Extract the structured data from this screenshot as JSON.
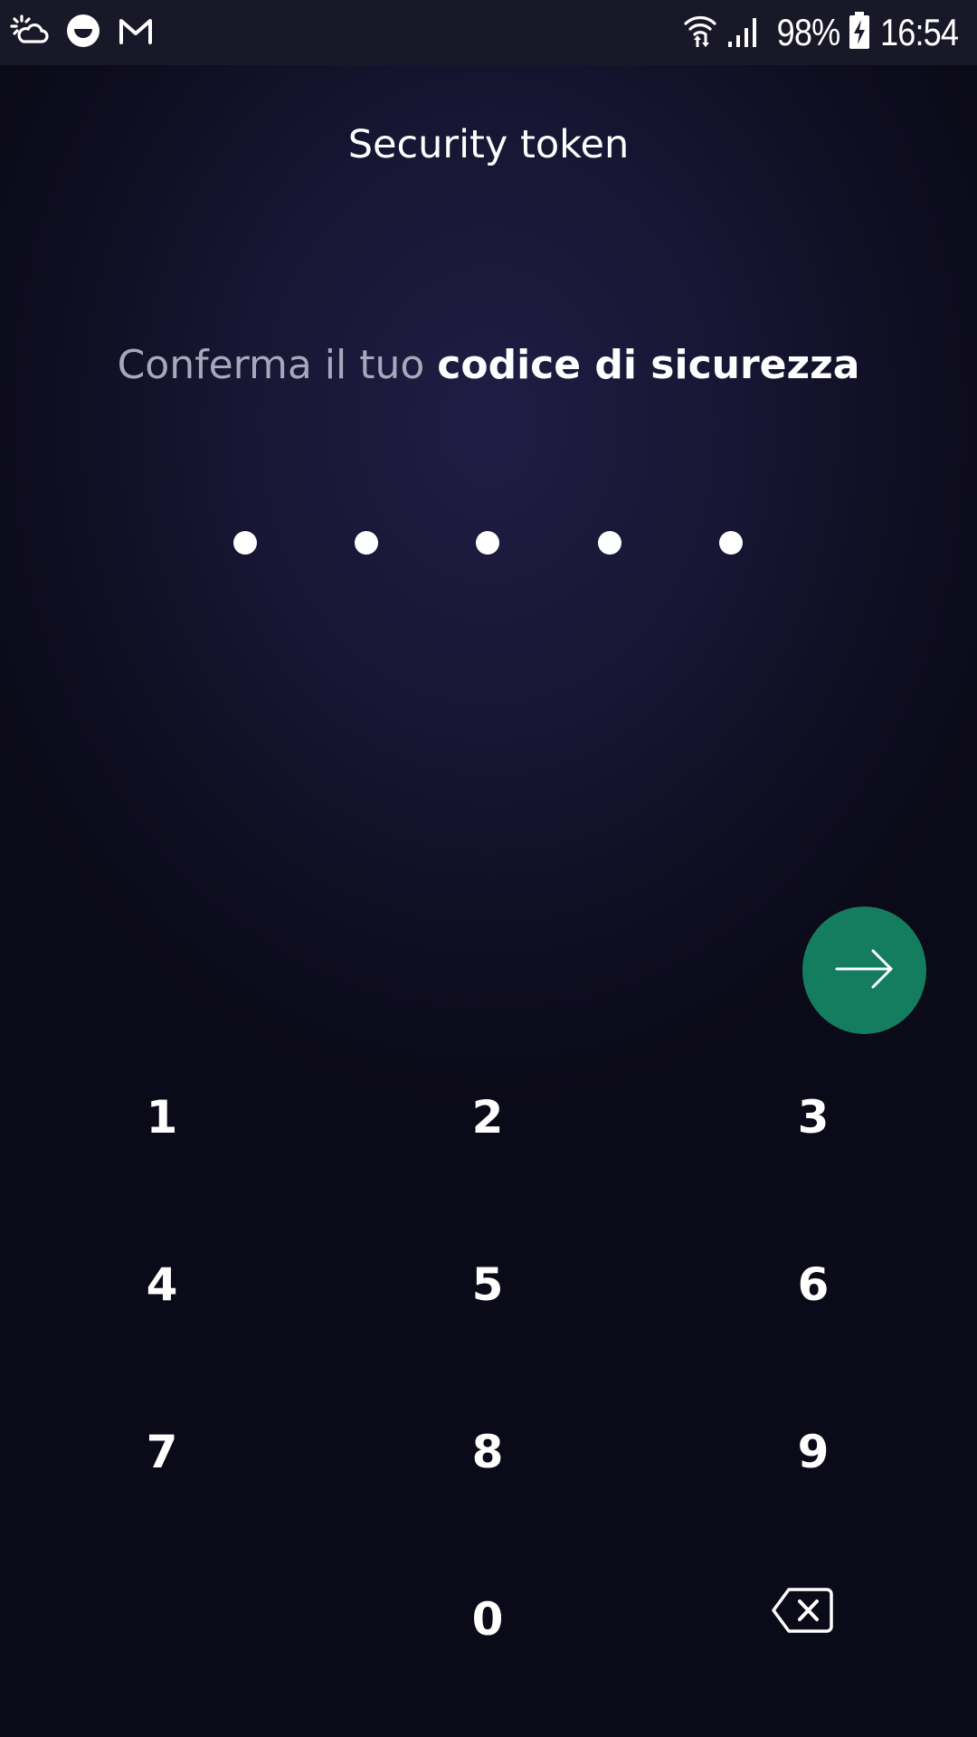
{
  "status_bar": {
    "battery_text": "98%",
    "time": "16:54",
    "left_icons": [
      "weather-cloud-icon",
      "app-face-icon",
      "gmail-icon"
    ],
    "right_icons": [
      "wifi-icon",
      "signal-icon",
      "battery-charging-icon"
    ]
  },
  "header": {
    "title": "Security token"
  },
  "prompt": {
    "light_text": "Conferma il tuo ",
    "bold_text": "codice di sicurezza"
  },
  "pin": {
    "length": 5,
    "filled": 5
  },
  "submit": {
    "icon": "arrow-right-icon",
    "color": "#157d5f"
  },
  "keypad": {
    "keys": [
      "1",
      "2",
      "3",
      "4",
      "5",
      "6",
      "7",
      "8",
      "9",
      "0"
    ],
    "backspace_icon": "backspace-icon"
  },
  "colors": {
    "background": "#171633",
    "status_bar": "#181828",
    "accent": "#157d5f",
    "prompt_light": "#a9a8bb",
    "text": "#ffffff"
  }
}
